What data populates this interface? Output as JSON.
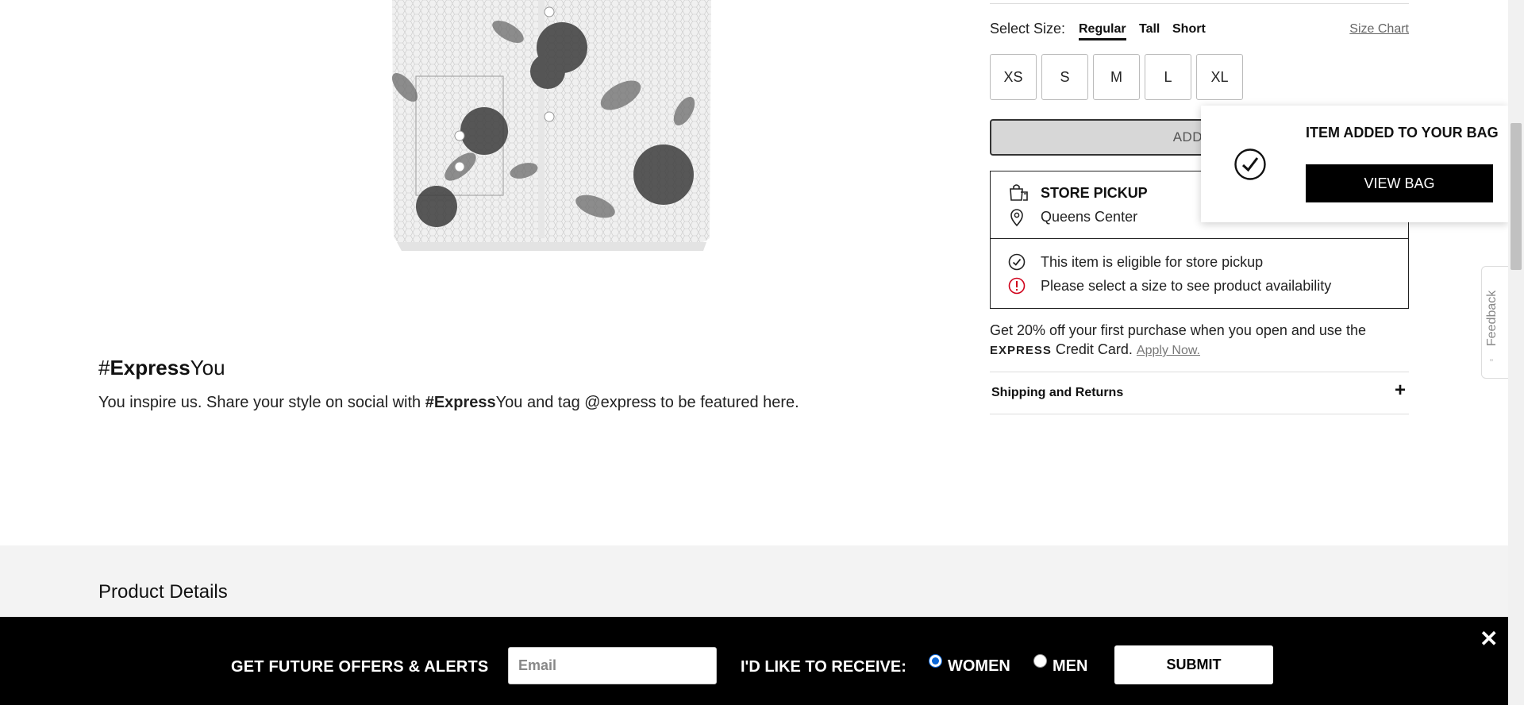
{
  "hashtag": {
    "prefix": "#",
    "brand": "Express",
    "suffix": "You",
    "desc_before": "You inspire us. Share your style on social with ",
    "desc_tag_brand": "#Express",
    "desc_tag_suffix": "You",
    "desc_after": " and tag @express to be featured here."
  },
  "size": {
    "label": "Select Size:",
    "types": [
      "Regular",
      "Tall",
      "Short"
    ],
    "active_type": "Regular",
    "chart_link": "Size Chart",
    "options": [
      "XS",
      "S",
      "M",
      "L",
      "XL"
    ]
  },
  "add_to_bag": {
    "label": "ADD TO"
  },
  "pickup": {
    "title": "STORE PICKUP",
    "store": "Queens Center",
    "eligible": "This item is eligible for store pickup",
    "select_size_msg": "Please select a size to see product availability"
  },
  "promo": {
    "text1": "Get 20% off your first purchase when you open and use the",
    "brand": "EXPRESS",
    "text2": " Credit Card. ",
    "apply_link": "Apply Now."
  },
  "shipping": {
    "label": "Shipping and Returns",
    "toggle": "+"
  },
  "popup": {
    "title": "ITEM ADDED TO YOUR BAG",
    "button": "VIEW BAG"
  },
  "feedback": {
    "label": "Feedback"
  },
  "details": {
    "title": "Product Details"
  },
  "signup": {
    "label": "GET FUTURE OFFERS & ALERTS",
    "email_placeholder": "Email",
    "receive_label": "I'D LIKE TO RECEIVE:",
    "option_women": "WOMEN",
    "option_men": "MEN",
    "selected": "WOMEN",
    "submit": "SUBMIT",
    "close": "✕"
  },
  "colors": {
    "accent_radio": "#0a66d8",
    "alert_red": "#d0021b"
  }
}
